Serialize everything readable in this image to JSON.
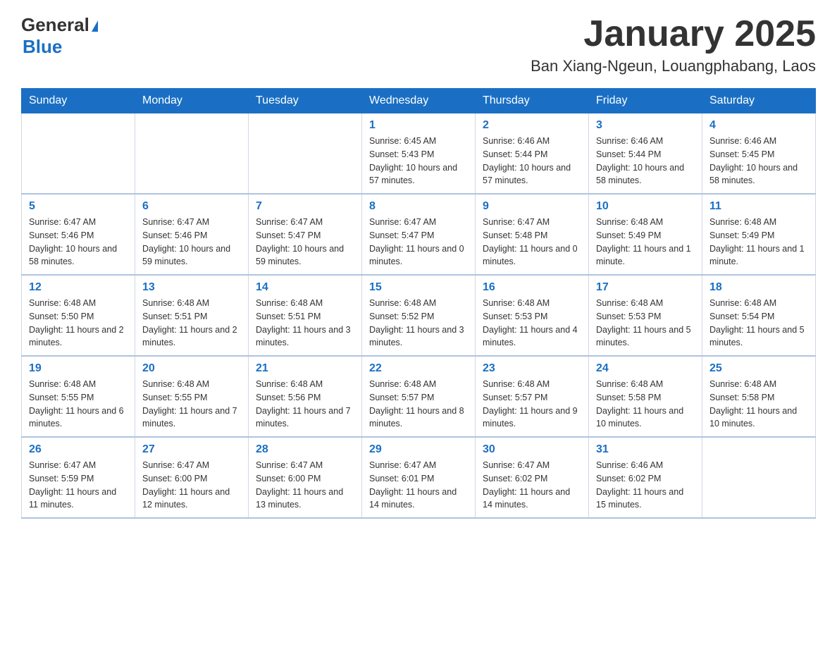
{
  "header": {
    "logo_general": "General",
    "logo_blue": "Blue",
    "month_title": "January 2025",
    "location": "Ban Xiang-Ngeun, Louangphabang, Laos"
  },
  "weekdays": [
    "Sunday",
    "Monday",
    "Tuesday",
    "Wednesday",
    "Thursday",
    "Friday",
    "Saturday"
  ],
  "weeks": [
    [
      {
        "day": "",
        "info": ""
      },
      {
        "day": "",
        "info": ""
      },
      {
        "day": "",
        "info": ""
      },
      {
        "day": "1",
        "info": "Sunrise: 6:45 AM\nSunset: 5:43 PM\nDaylight: 10 hours and 57 minutes."
      },
      {
        "day": "2",
        "info": "Sunrise: 6:46 AM\nSunset: 5:44 PM\nDaylight: 10 hours and 57 minutes."
      },
      {
        "day": "3",
        "info": "Sunrise: 6:46 AM\nSunset: 5:44 PM\nDaylight: 10 hours and 58 minutes."
      },
      {
        "day": "4",
        "info": "Sunrise: 6:46 AM\nSunset: 5:45 PM\nDaylight: 10 hours and 58 minutes."
      }
    ],
    [
      {
        "day": "5",
        "info": "Sunrise: 6:47 AM\nSunset: 5:46 PM\nDaylight: 10 hours and 58 minutes."
      },
      {
        "day": "6",
        "info": "Sunrise: 6:47 AM\nSunset: 5:46 PM\nDaylight: 10 hours and 59 minutes."
      },
      {
        "day": "7",
        "info": "Sunrise: 6:47 AM\nSunset: 5:47 PM\nDaylight: 10 hours and 59 minutes."
      },
      {
        "day": "8",
        "info": "Sunrise: 6:47 AM\nSunset: 5:47 PM\nDaylight: 11 hours and 0 minutes."
      },
      {
        "day": "9",
        "info": "Sunrise: 6:47 AM\nSunset: 5:48 PM\nDaylight: 11 hours and 0 minutes."
      },
      {
        "day": "10",
        "info": "Sunrise: 6:48 AM\nSunset: 5:49 PM\nDaylight: 11 hours and 1 minute."
      },
      {
        "day": "11",
        "info": "Sunrise: 6:48 AM\nSunset: 5:49 PM\nDaylight: 11 hours and 1 minute."
      }
    ],
    [
      {
        "day": "12",
        "info": "Sunrise: 6:48 AM\nSunset: 5:50 PM\nDaylight: 11 hours and 2 minutes."
      },
      {
        "day": "13",
        "info": "Sunrise: 6:48 AM\nSunset: 5:51 PM\nDaylight: 11 hours and 2 minutes."
      },
      {
        "day": "14",
        "info": "Sunrise: 6:48 AM\nSunset: 5:51 PM\nDaylight: 11 hours and 3 minutes."
      },
      {
        "day": "15",
        "info": "Sunrise: 6:48 AM\nSunset: 5:52 PM\nDaylight: 11 hours and 3 minutes."
      },
      {
        "day": "16",
        "info": "Sunrise: 6:48 AM\nSunset: 5:53 PM\nDaylight: 11 hours and 4 minutes."
      },
      {
        "day": "17",
        "info": "Sunrise: 6:48 AM\nSunset: 5:53 PM\nDaylight: 11 hours and 5 minutes."
      },
      {
        "day": "18",
        "info": "Sunrise: 6:48 AM\nSunset: 5:54 PM\nDaylight: 11 hours and 5 minutes."
      }
    ],
    [
      {
        "day": "19",
        "info": "Sunrise: 6:48 AM\nSunset: 5:55 PM\nDaylight: 11 hours and 6 minutes."
      },
      {
        "day": "20",
        "info": "Sunrise: 6:48 AM\nSunset: 5:55 PM\nDaylight: 11 hours and 7 minutes."
      },
      {
        "day": "21",
        "info": "Sunrise: 6:48 AM\nSunset: 5:56 PM\nDaylight: 11 hours and 7 minutes."
      },
      {
        "day": "22",
        "info": "Sunrise: 6:48 AM\nSunset: 5:57 PM\nDaylight: 11 hours and 8 minutes."
      },
      {
        "day": "23",
        "info": "Sunrise: 6:48 AM\nSunset: 5:57 PM\nDaylight: 11 hours and 9 minutes."
      },
      {
        "day": "24",
        "info": "Sunrise: 6:48 AM\nSunset: 5:58 PM\nDaylight: 11 hours and 10 minutes."
      },
      {
        "day": "25",
        "info": "Sunrise: 6:48 AM\nSunset: 5:58 PM\nDaylight: 11 hours and 10 minutes."
      }
    ],
    [
      {
        "day": "26",
        "info": "Sunrise: 6:47 AM\nSunset: 5:59 PM\nDaylight: 11 hours and 11 minutes."
      },
      {
        "day": "27",
        "info": "Sunrise: 6:47 AM\nSunset: 6:00 PM\nDaylight: 11 hours and 12 minutes."
      },
      {
        "day": "28",
        "info": "Sunrise: 6:47 AM\nSunset: 6:00 PM\nDaylight: 11 hours and 13 minutes."
      },
      {
        "day": "29",
        "info": "Sunrise: 6:47 AM\nSunset: 6:01 PM\nDaylight: 11 hours and 14 minutes."
      },
      {
        "day": "30",
        "info": "Sunrise: 6:47 AM\nSunset: 6:02 PM\nDaylight: 11 hours and 14 minutes."
      },
      {
        "day": "31",
        "info": "Sunrise: 6:46 AM\nSunset: 6:02 PM\nDaylight: 11 hours and 15 minutes."
      },
      {
        "day": "",
        "info": ""
      }
    ]
  ]
}
